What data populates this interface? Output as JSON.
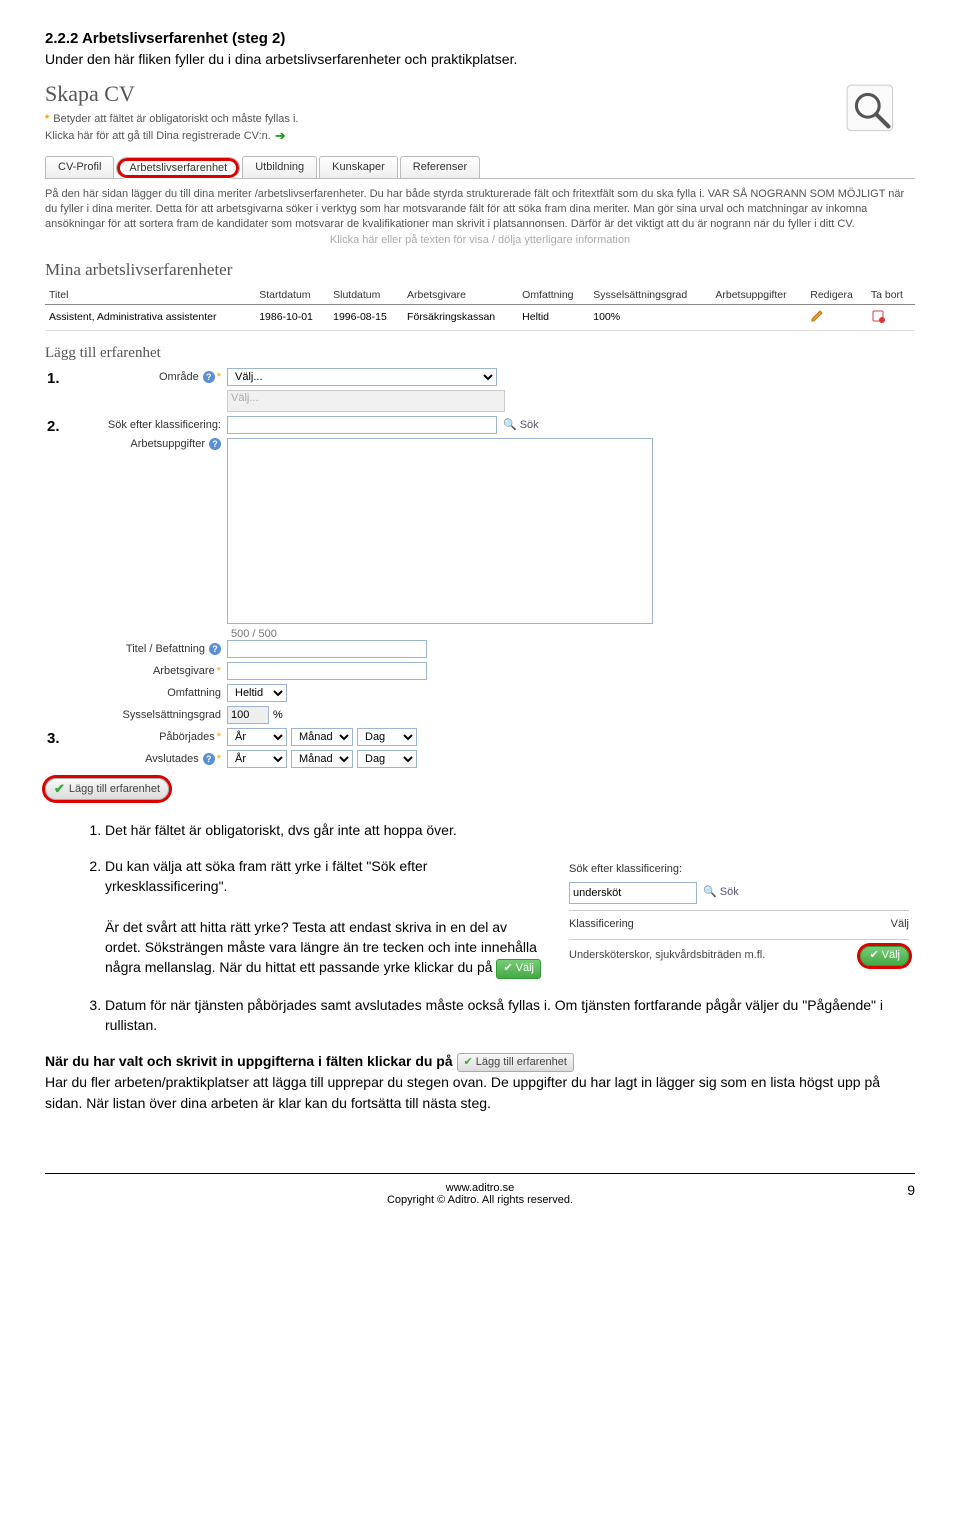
{
  "heading": "2.2.2 Arbetslivserfarenhet (steg 2)",
  "intro": "Under den här fliken fyller du i dina arbetslivserfarenheter och praktikplatser.",
  "app": {
    "title": "Skapa CV",
    "help1_star": "*",
    "help1": "Betyder att fältet är obligatoriskt och måste fyllas i.",
    "help2": "Klicka här för att gå till Dina registrerade CV:n.",
    "tabs": {
      "profile": "CV-Profil",
      "experience": "Arbetslivserfarenhet",
      "education": "Utbildning",
      "skills": "Kunskaper",
      "references": "Referenser"
    },
    "desc": "På den här sidan lägger du till dina meriter /arbetslivserfarenheter. Du har både styrda strukturerade fält och fritextfält som du ska fylla i. VAR SÅ NOGRANN SOM MÖJLIGT när du fyller i dina meriter. Detta för att arbetsgivarna söker i verktyg som har motsvarande fält för att söka fram dina meriter. Man gör sina urval och matchningar av inkomna ansökningar för att sortera fram de kandidater som motsvarar de kvalifikationer man skrivit i platsannonsen. Därför är det viktigt att du är nogrann när du fyller i ditt CV.",
    "desc_faded": "Klicka här eller på texten för visa / dölja ytterligare information",
    "sub_title": "Mina arbetslivserfarenheter",
    "table": {
      "headers": {
        "titel": "Titel",
        "start": "Startdatum",
        "slut": "Slutdatum",
        "arbetsgivare": "Arbetsgivare",
        "omf": "Omfattning",
        "syssel": "Sysselsättningsgrad",
        "uppg": "Arbetsuppgifter",
        "redigera": "Redigera",
        "tabort": "Ta bort"
      },
      "row": {
        "titel": "Assistent, Administrativa assistenter",
        "start": "1986-10-01",
        "slut": "1996-08-15",
        "arbetsgivare": "Försäkringskassan",
        "omf": "Heltid",
        "syssel": "100%",
        "uppg": ""
      }
    },
    "add_title": "Lägg till erfarenhet",
    "form": {
      "omrade_label": "Område",
      "omrade_value": "Välj...",
      "sub_value": "Välj...",
      "sok_klass_label": "Sök efter klassificering:",
      "sok_button": "Sök",
      "arbetsuppgifter_label": "Arbetsuppgifter",
      "counter": "500 / 500",
      "titel_label": "Titel / Befattning",
      "arbetsgivare_label": "Arbetsgivare",
      "omfattning_label": "Omfattning",
      "omfattning_value": "Heltid",
      "syssel_label": "Sysselsättningsgrad",
      "syssel_value": "100",
      "syssel_unit": "%",
      "paborjades_label": "Påbörjades",
      "avslutades_label": "Avslutades",
      "ar": "År",
      "manad": "Månad",
      "dag": "Dag",
      "submit_label": "Lägg till erfarenhet"
    }
  },
  "markers": {
    "m1": "1.",
    "m2": "2.",
    "m3": "3."
  },
  "list": {
    "item1": "Det här fältet är obligatoriskt, dvs går inte att hoppa över.",
    "item2a": "Du kan välja att söka fram rätt yrke i fältet \"Sök efter yrkesklassificering\".",
    "item2b": "Är det svårt att hitta rätt yrke? Testa att endast skriva in en del av ordet. Söksträngen måste vara längre än tre tecken och inte innehålla några mellanslag. När du hittat ett passande yrke klickar du på",
    "item3": "Datum för när tjänsten påbörjades samt avslutades måste också fyllas i. Om tjänsten fortfarande pågår väljer du \"Pågående\" i rullistan."
  },
  "popup": {
    "sok_label": "Sök efter klassificering:",
    "sok_value": "undersköt",
    "sok_btn": "Sök",
    "klass_header": "Klassificering",
    "valj_header": "Välj",
    "result": "Undersköterskor, sjukvårdsbiträden m.fl.",
    "valj_btn": "Välj"
  },
  "inline_valj": "Välj",
  "final": {
    "bold1": "När du har valt och skrivit in uppgifterna i fälten klickar du på",
    "btn_label": "Lägg till erfarenhet",
    "rest": "Har du fler arbeten/praktikplatser att lägga till upprepar du stegen ovan. De uppgifter du har lagt in lägger sig som en lista högst upp på sidan. När listan över dina arbeten är klar kan du fortsätta till nästa steg."
  },
  "footer": {
    "url": "www.aditro.se",
    "copyright": "Copyright © Aditro. All rights reserved.",
    "page": "9"
  }
}
